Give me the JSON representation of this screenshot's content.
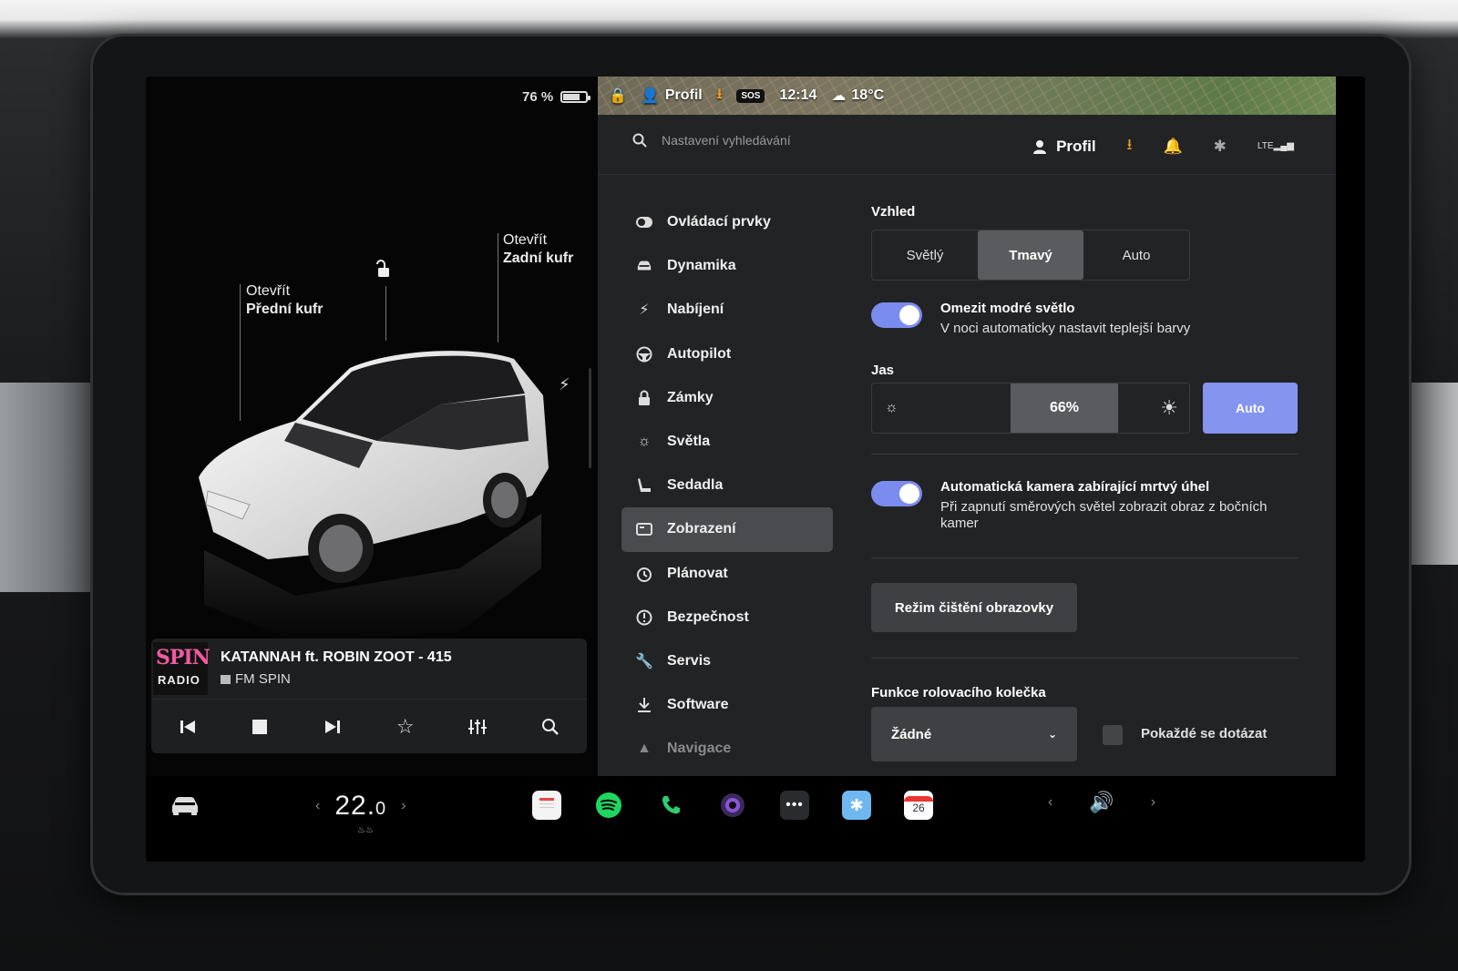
{
  "status": {
    "battery": "76 %",
    "profile": "Profil",
    "time": "12:14",
    "temperature": "18°C",
    "sos": "SOS"
  },
  "car": {
    "front_trunk_action": "Otevřít",
    "front_trunk_label": "Přední kufr",
    "rear_trunk_action": "Otevřít",
    "rear_trunk_label": "Zadní kufr"
  },
  "media": {
    "logo_line1": "SPIN",
    "logo_line2": "RADIO",
    "track": "KATANNAH ft. ROBIN ZOOT - 415",
    "station": "FM SPIN"
  },
  "search": {
    "placeholder": "Nastavení vyhledávání"
  },
  "header": {
    "profile": "Profil"
  },
  "nav": {
    "items": [
      {
        "label": "Ovládací prvky",
        "icon": "toggle-icon"
      },
      {
        "label": "Dynamika",
        "icon": "car-icon"
      },
      {
        "label": "Nabíjení",
        "icon": "bolt-icon"
      },
      {
        "label": "Autopilot",
        "icon": "steering-wheel-icon"
      },
      {
        "label": "Zámky",
        "icon": "lock-icon"
      },
      {
        "label": "Světla",
        "icon": "sun-icon"
      },
      {
        "label": "Sedadla",
        "icon": "seat-icon"
      },
      {
        "label": "Zobrazení",
        "icon": "display-icon",
        "active": true
      },
      {
        "label": "Plánovat",
        "icon": "alarm-icon"
      },
      {
        "label": "Bezpečnost",
        "icon": "alert-circle-icon"
      },
      {
        "label": "Servis",
        "icon": "wrench-icon"
      },
      {
        "label": "Software",
        "icon": "download-icon"
      },
      {
        "label": "Navigace",
        "icon": "navigation-icon"
      }
    ]
  },
  "display": {
    "appearance_title": "Vzhled",
    "appearance_options": [
      "Světlý",
      "Tmavý",
      "Auto"
    ],
    "appearance_selected": "Tmavý",
    "blue_light_title": "Omezit modré světlo",
    "blue_light_desc": "V noci automaticky nastavit teplejší barvy",
    "blue_light_on": true,
    "brightness_title": "Jas",
    "brightness_value": "66%",
    "brightness_level": 0.66,
    "brightness_auto": "Auto",
    "blindspot_title": "Automatická kamera zabírající mrtvý úhel",
    "blindspot_desc_1": "Při zapnutí směrových světel zobrazit obraz z bočních",
    "blindspot_desc_2": "kamer",
    "blindspot_on": true,
    "clean_button": "Režim čištění obrazovky",
    "scroll_title": "Funkce rolovacího kolečka",
    "scroll_value": "Žádné",
    "ask_label": "Pokaždé se dotázat"
  },
  "dock": {
    "temp_int": "22.",
    "temp_dec": "0",
    "calendar_day": "26",
    "apps": [
      "notes-icon",
      "spotify-icon",
      "phone-icon",
      "camera-icon",
      "more-icon",
      "bluetooth-icon",
      "calendar-icon"
    ]
  },
  "colors": {
    "accent": "#8494ef",
    "toggle": "#7b8cf0",
    "download": "#f0a020",
    "spotify": "#1ed760",
    "phone": "#2ecc71"
  }
}
